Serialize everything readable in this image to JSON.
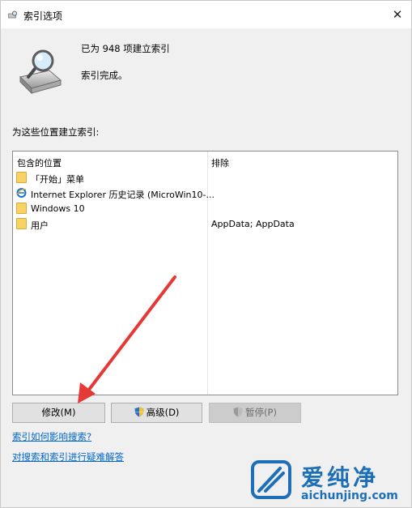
{
  "window": {
    "title": "索引选项",
    "close_label": "✕"
  },
  "status": {
    "indexed_count": "已为 948 项建立索引",
    "message": "索引完成。"
  },
  "section_label": "为这些位置建立索引:",
  "table": {
    "columns": [
      "包含的位置",
      "排除"
    ],
    "rows": [
      {
        "icon": "folder-icon",
        "location": "「开始」菜单",
        "exclude": ""
      },
      {
        "icon": "internet-explorer-icon",
        "location": "Internet Explorer 历史记录 (MicroWin10-...",
        "exclude": ""
      },
      {
        "icon": "folder-icon",
        "location": "Windows 10",
        "exclude": ""
      },
      {
        "icon": "folder-icon",
        "location": "用户",
        "exclude": "AppData; AppData"
      }
    ]
  },
  "buttons": {
    "modify": "修改(M)",
    "advanced": "高级(D)",
    "pause": "暂停(P)"
  },
  "links": {
    "how_affects": "索引如何影响搜索?",
    "troubleshoot": "对搜索和索引进行疑难解答"
  },
  "watermark": {
    "brand": "爱纯净",
    "domain": "aichunjing.com"
  },
  "colors": {
    "link": "#0066cc",
    "arrow": "#e53935",
    "folder": "#f6d267",
    "watermark_blue": "#1d6fb8"
  }
}
